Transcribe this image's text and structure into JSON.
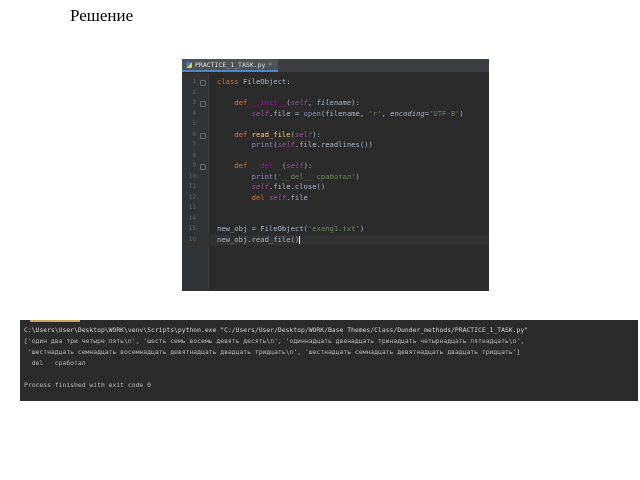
{
  "slide": {
    "title": "Решение"
  },
  "editor": {
    "tab": {
      "label": "PRACTICE_1_TASK.py",
      "close_glyph": "×",
      "icon": "python-file-icon"
    },
    "lines": [
      {
        "n": "1",
        "parts": [
          {
            "t": "class ",
            "c": "kw"
          },
          {
            "t": "FileObject",
            "c": ""
          },
          {
            "t": ":",
            "c": ""
          }
        ]
      },
      {
        "n": "2",
        "parts": []
      },
      {
        "n": "3",
        "parts": [
          {
            "t": "    def ",
            "c": "kw"
          },
          {
            "t": "__init__",
            "c": "dunder"
          },
          {
            "t": "(",
            "c": ""
          },
          {
            "t": "self",
            "c": "self"
          },
          {
            "t": ", ",
            "c": ""
          },
          {
            "t": "filename",
            "c": "param"
          },
          {
            "t": "):",
            "c": ""
          }
        ]
      },
      {
        "n": "4",
        "parts": [
          {
            "t": "        ",
            "c": ""
          },
          {
            "t": "self",
            "c": "self"
          },
          {
            "t": ".file = ",
            "c": ""
          },
          {
            "t": "open",
            "c": "bi"
          },
          {
            "t": "(filename, ",
            "c": ""
          },
          {
            "t": "'r'",
            "c": "str"
          },
          {
            "t": ", ",
            "c": ""
          },
          {
            "t": "encoding",
            "c": "param"
          },
          {
            "t": "=",
            "c": ""
          },
          {
            "t": "'UTF-8'",
            "c": "str"
          },
          {
            "t": ")",
            "c": ""
          }
        ]
      },
      {
        "n": "5",
        "parts": []
      },
      {
        "n": "6",
        "parts": [
          {
            "t": "    def ",
            "c": "kw"
          },
          {
            "t": "read_file",
            "c": "fn"
          },
          {
            "t": "(",
            "c": ""
          },
          {
            "t": "self",
            "c": "self"
          },
          {
            "t": "):",
            "c": ""
          }
        ]
      },
      {
        "n": "7",
        "parts": [
          {
            "t": "        ",
            "c": ""
          },
          {
            "t": "print",
            "c": "bi"
          },
          {
            "t": "(",
            "c": ""
          },
          {
            "t": "self",
            "c": "self"
          },
          {
            "t": ".file.readlines())",
            "c": ""
          }
        ]
      },
      {
        "n": "8",
        "parts": []
      },
      {
        "n": "9",
        "parts": [
          {
            "t": "    def ",
            "c": "kw"
          },
          {
            "t": "__del__",
            "c": "dunder"
          },
          {
            "t": "(",
            "c": ""
          },
          {
            "t": "self",
            "c": "self"
          },
          {
            "t": "):",
            "c": ""
          }
        ]
      },
      {
        "n": "10",
        "parts": [
          {
            "t": "        ",
            "c": ""
          },
          {
            "t": "print",
            "c": "bi"
          },
          {
            "t": "(",
            "c": ""
          },
          {
            "t": "'__del__ сработал'",
            "c": "str"
          },
          {
            "t": ")",
            "c": ""
          }
        ]
      },
      {
        "n": "11",
        "parts": [
          {
            "t": "        ",
            "c": ""
          },
          {
            "t": "self",
            "c": "self"
          },
          {
            "t": ".file.close()",
            "c": ""
          }
        ]
      },
      {
        "n": "12",
        "parts": [
          {
            "t": "        ",
            "c": ""
          },
          {
            "t": "del ",
            "c": "kw"
          },
          {
            "t": "self",
            "c": "self"
          },
          {
            "t": ".file",
            "c": ""
          }
        ]
      },
      {
        "n": "13",
        "parts": []
      },
      {
        "n": "14",
        "parts": []
      },
      {
        "n": "15",
        "parts": [
          {
            "t": "new_obj = FileObject(",
            "c": ""
          },
          {
            "t": "'exang1.txt'",
            "c": "str"
          },
          {
            "t": ")",
            "c": ""
          }
        ]
      },
      {
        "n": "16",
        "parts": [
          {
            "t": "new_obj.read_file()",
            "c": ""
          }
        ],
        "current": true
      }
    ]
  },
  "console": {
    "lines": [
      "C:\\Users\\User\\Desktop\\WORK\\venv\\Scripts\\python.exe \"C:/Users/User/Desktop/WORK/Base Themes/Class/Dunder_methods/PRACTICE_1_TASK.py\"",
      "['один два три четыре пять\\n', 'шесть семь восемь девять десять\\n', 'одиннадцать двенадцать тринадцать четырнадцать пятнадцать\\n',",
      " 'шестнадцать семнадцать восемнадцать девятнадцать двадцать тридцать\\n', 'шестнадцать семнадцать девятнадцать двадцать тридцать']",
      "  del   сработал",
      "",
      "Process finished with exit code 0"
    ]
  }
}
